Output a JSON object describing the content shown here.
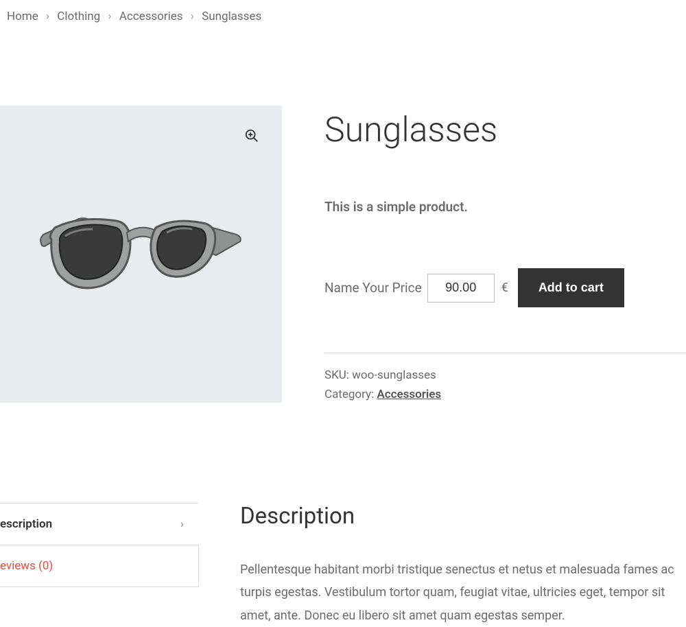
{
  "breadcrumb": {
    "items": [
      "Home",
      "Clothing",
      "Accessories",
      "Sunglasses"
    ],
    "sep": "›"
  },
  "product": {
    "title": "Sunglasses",
    "short_description": "This is a simple product.",
    "price": {
      "label": "Name Your Price",
      "value": "90.00",
      "currency": "€"
    },
    "add_to_cart_label": "Add to cart",
    "meta": {
      "sku_label": "SKU:",
      "sku_value": "woo-sunglasses",
      "category_label": "Category:",
      "category_value": "Accessories"
    }
  },
  "tabs": {
    "description": {
      "label": "escription"
    },
    "reviews": {
      "label": "eviews (0)"
    }
  },
  "description_section": {
    "heading": "Description",
    "body": "Pellentesque habitant morbi tristique senectus et netus et malesuada fames ac turpis egestas. Vestibulum tortor quam, feugiat vitae, ultricies eget, tempor sit amet, ante. Donec eu libero sit amet quam egestas semper."
  }
}
